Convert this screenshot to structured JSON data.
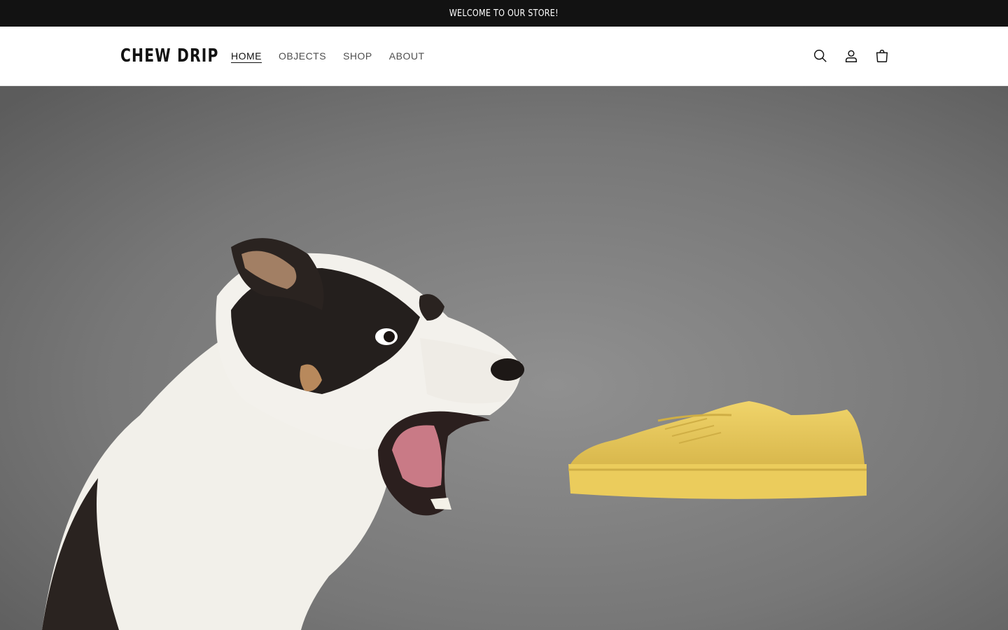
{
  "announcement": {
    "text": "WELCOME TO OUR STORE!"
  },
  "header": {
    "logo": "CHEW DRIP",
    "nav": [
      {
        "label": "HOME",
        "active": true
      },
      {
        "label": "OBJECTS",
        "active": false
      },
      {
        "label": "SHOP",
        "active": false
      },
      {
        "label": "ABOUT",
        "active": false
      }
    ],
    "icons": [
      "search-icon",
      "account-icon",
      "cart-icon"
    ]
  },
  "hero": {
    "image": "dog-lunging-at-yellow-sneaker",
    "colors": {
      "background": "#7a7a7a",
      "sneaker": "#e6c65a"
    }
  },
  "colors": {
    "announcement_bg": "#121212",
    "text": "#121212"
  }
}
